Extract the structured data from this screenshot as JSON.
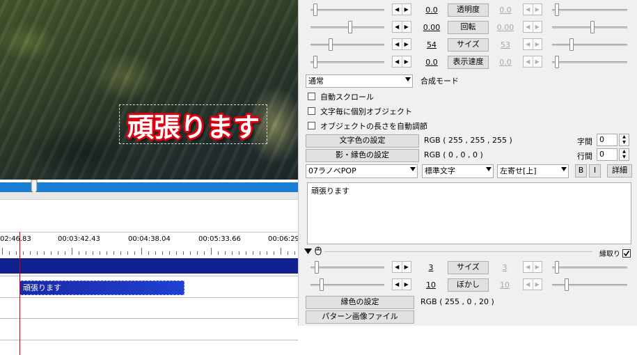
{
  "preview": {
    "text": "頑張ります"
  },
  "timeline": {
    "ruler_labels": [
      "02:46.83",
      "00:03:42.43",
      "00:04:38.04",
      "00:05:33.66",
      "00:06:29."
    ],
    "clip_label": "頑張ります"
  },
  "panel": {
    "rows": [
      {
        "left_value": "0.0",
        "label": "透明度",
        "right_value": "0.0"
      },
      {
        "left_value": "0.00",
        "label": "回転",
        "right_value": "0.00"
      },
      {
        "left_value": "54",
        "label": "サイズ",
        "right_value": "53"
      },
      {
        "left_value": "0.0",
        "label": "表示速度",
        "right_value": "0.0"
      }
    ],
    "blend_mode": {
      "selected": "通常",
      "label": "合成モード"
    },
    "checkboxes": [
      {
        "label": "自動スクロール",
        "checked": false
      },
      {
        "label": "文字毎に個別オブジェクト",
        "checked": false
      },
      {
        "label": "オブジェクトの長さを自動調節",
        "checked": false
      }
    ],
    "text_color": {
      "button": "文字色の設定",
      "value": "RGB ( 255 , 255 , 255 )"
    },
    "shadow_color": {
      "button": "影・縁色の設定",
      "value": "RGB ( 0 , 0 , 0 )"
    },
    "char_spacing": {
      "label": "字間",
      "value": "0"
    },
    "line_spacing": {
      "label": "行間",
      "value": "0"
    },
    "font": "07ラノベPOP",
    "decoration": "標準文字",
    "align": "左寄せ[上]",
    "bold_label": "B",
    "italic_label": "I",
    "detail_label": "詳細",
    "text_content": "頑張ります",
    "filter_name": "縁取り",
    "filter_checked": true,
    "border_rows": [
      {
        "left_value": "3",
        "label": "サイズ",
        "right_value": "3"
      },
      {
        "left_value": "10",
        "label": "ぼかし",
        "right_value": "10"
      }
    ],
    "border_color": {
      "button": "縁色の設定",
      "value": "RGB ( 255 , 0 , 20 )"
    },
    "pattern_button": "パターン画像ファイル",
    "arrow_left": "◀",
    "arrow_right": "▶"
  },
  "colors": {
    "seekbar": "#1a7fd4",
    "layer": "#10208c",
    "clip": "#2040d0",
    "playhead": "#d00000",
    "text_border": "#ff0014"
  }
}
